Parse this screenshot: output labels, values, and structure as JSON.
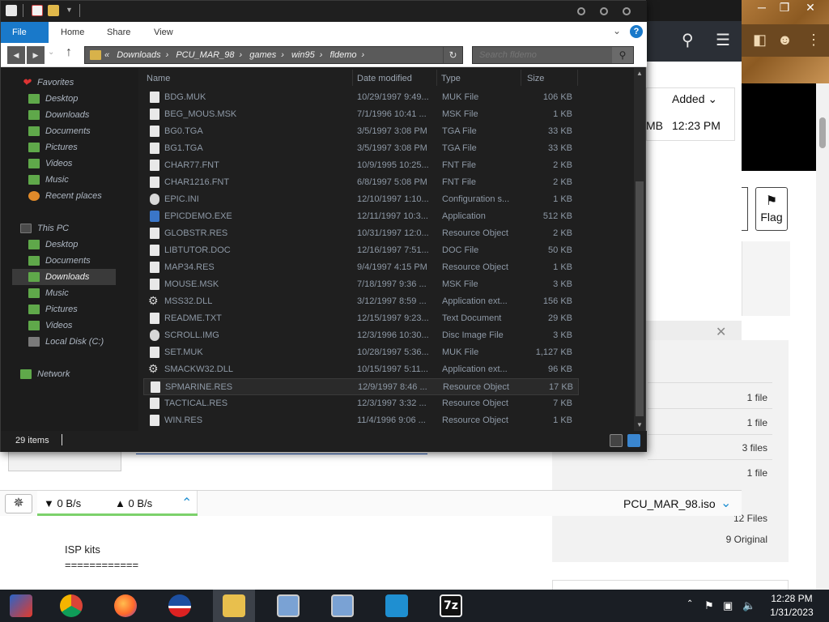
{
  "explorer": {
    "ribbon_tabs": [
      "File",
      "Home",
      "Share",
      "View"
    ],
    "breadcrumb_prefix": "«",
    "breadcrumb": [
      "Downloads",
      "PCU_MAR_98",
      "games",
      "win95",
      "fldemo"
    ],
    "search_placeholder": "Search fldemo",
    "nav_pane": {
      "favorites_label": "Favorites",
      "favorites": [
        "Desktop",
        "Downloads",
        "Documents",
        "Pictures",
        "Videos",
        "Music",
        "Recent places"
      ],
      "this_pc_label": "This PC",
      "this_pc": [
        "Desktop",
        "Documents",
        "Downloads",
        "Music",
        "Pictures",
        "Videos",
        "Local Disk (C:)"
      ],
      "network_label": "Network",
      "selected": "Downloads"
    },
    "columns": [
      "Name",
      "Date modified",
      "Type",
      "Size"
    ],
    "files": [
      {
        "name": "BDG.MUK",
        "date": "10/29/1997 9:49...",
        "type": "MUK File",
        "size": "106 KB",
        "icon": "file-icon"
      },
      {
        "name": "BEG_MOUS.MSK",
        "date": "7/1/1996 10:41 ...",
        "type": "MSK File",
        "size": "1 KB",
        "icon": "file-icon"
      },
      {
        "name": "BG0.TGA",
        "date": "3/5/1997 3:08 PM",
        "type": "TGA File",
        "size": "33 KB",
        "icon": "file-icon"
      },
      {
        "name": "BG1.TGA",
        "date": "3/5/1997 3:08 PM",
        "type": "TGA File",
        "size": "33 KB",
        "icon": "file-icon"
      },
      {
        "name": "CHAR77.FNT",
        "date": "10/9/1995 10:25...",
        "type": "FNT File",
        "size": "2 KB",
        "icon": "file-icon"
      },
      {
        "name": "CHAR1216.FNT",
        "date": "6/8/1997 5:08 PM",
        "type": "FNT File",
        "size": "2 KB",
        "icon": "file-icon"
      },
      {
        "name": "EPIC.INI",
        "date": "12/10/1997 1:10...",
        "type": "Configuration s...",
        "size": "1 KB",
        "icon": "config-icon"
      },
      {
        "name": "EPICDEMO.EXE",
        "date": "12/11/1997 10:3...",
        "type": "Application",
        "size": "512 KB",
        "icon": "application-icon"
      },
      {
        "name": "GLOBSTR.RES",
        "date": "10/31/1997 12:0...",
        "type": "Resource Object",
        "size": "2 KB",
        "icon": "file-icon"
      },
      {
        "name": "LIBTUTOR.DOC",
        "date": "12/16/1997 7:51...",
        "type": "DOC File",
        "size": "50 KB",
        "icon": "file-icon"
      },
      {
        "name": "MAP34.RES",
        "date": "9/4/1997 4:15 PM",
        "type": "Resource Object",
        "size": "1 KB",
        "icon": "file-icon"
      },
      {
        "name": "MOUSE.MSK",
        "date": "7/18/1997 9:36 ...",
        "type": "MSK File",
        "size": "3 KB",
        "icon": "file-icon"
      },
      {
        "name": "MSS32.DLL",
        "date": "3/12/1997 8:59 ...",
        "type": "Application ext...",
        "size": "156 KB",
        "icon": "gear-icon"
      },
      {
        "name": "README.TXT",
        "date": "12/15/1997 9:23...",
        "type": "Text Document",
        "size": "29 KB",
        "icon": "file-icon"
      },
      {
        "name": "SCROLL.IMG",
        "date": "12/3/1996 10:30...",
        "type": "Disc Image File",
        "size": "3 KB",
        "icon": "disc-image-icon"
      },
      {
        "name": "SET.MUK",
        "date": "10/28/1997 5:36...",
        "type": "MUK File",
        "size": "1,127 KB",
        "icon": "file-icon"
      },
      {
        "name": "SMACKW32.DLL",
        "date": "10/15/1997 5:11...",
        "type": "Application ext...",
        "size": "96 KB",
        "icon": "gear-icon"
      },
      {
        "name": "SPMARINE.RES",
        "date": "12/9/1997 8:46 ...",
        "type": "Resource Object",
        "size": "17 KB",
        "icon": "file-icon"
      },
      {
        "name": "TACTICAL.RES",
        "date": "12/3/1997 3:32 ...",
        "type": "Resource Object",
        "size": "7 KB",
        "icon": "file-icon"
      },
      {
        "name": "WIN.RES",
        "date": "11/4/1996 9:06 ...",
        "type": "Resource Object",
        "size": "1 KB",
        "icon": "file-icon"
      }
    ],
    "status_count": "29 items"
  },
  "browser": {
    "added_header": "Added",
    "row_size_suffix": "MB",
    "row_time": "12:23 PM",
    "flag_label": "Flag",
    "file_counts": [
      "1 file",
      "1 file",
      "3 files",
      "1 file",
      "12 Files",
      "9 Original"
    ],
    "isp_heading": "ISP kits",
    "isp_underline": "============"
  },
  "download_bar": {
    "down_speed": "▼ 0 B/s",
    "up_speed": "▲ 0 B/s",
    "filename": "PCU_MAR_98.iso"
  },
  "taskbar": {
    "apps": [
      "media-center-icon",
      "chrome-icon",
      "firefox-icon",
      "obama-logo-icon",
      "file-explorer-icon",
      "setup-installer-icon",
      "setup-installer-icon",
      "send-to-icon",
      "7zip-icon"
    ],
    "sevenzip_label": "7z",
    "time": "12:28 PM",
    "date": "1/31/2023"
  },
  "colors": {
    "ribbon_accent": "#1979ca",
    "explorer_bg": "#1f1f1f",
    "taskbar_bg": "#1a1e24",
    "download_progress": "#7cd16b"
  }
}
